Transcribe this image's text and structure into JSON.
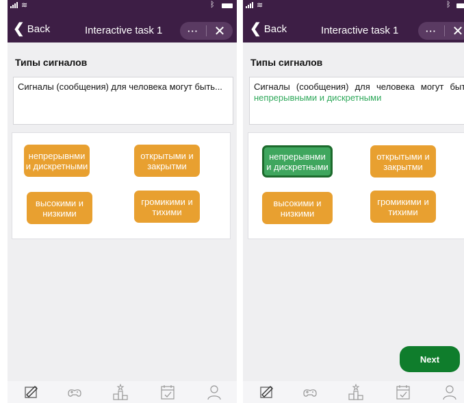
{
  "screens": [
    {
      "header": {
        "back_label": "Back",
        "title": "Interactive task 1",
        "more_glyph": "···",
        "close_glyph": "✕"
      },
      "section_title": "Типы сигналов",
      "question": {
        "text": "Сигналы (сообщения) для человека могут быть...",
        "answer": ""
      },
      "options": [
        {
          "label": "непрерывнми и дискретными",
          "selected": false
        },
        {
          "label": "открытыми и закрытми",
          "selected": false
        },
        {
          "label": "высокими и низкими",
          "selected": false
        },
        {
          "label": "громикими и тихими",
          "selected": false
        }
      ],
      "nav_icons": [
        "tasks-icon",
        "games-icon",
        "leaderboard-icon",
        "calendar-icon",
        "profile-icon"
      ]
    },
    {
      "header": {
        "back_label": "Back",
        "title": "Interactive task 1",
        "more_glyph": "···",
        "close_glyph": "✕"
      },
      "section_title": "Типы сигналов",
      "question": {
        "text": "Сигналы (сообщения) для человека могут быть ",
        "answer": "непрерывными и дискретными"
      },
      "options": [
        {
          "label": "непрерывнми и дискретными",
          "selected": true
        },
        {
          "label": "открытыми и закрытми",
          "selected": false
        },
        {
          "label": "высокими и низкими",
          "selected": false
        },
        {
          "label": "громикими и тихими",
          "selected": false
        }
      ],
      "next_label": "Next",
      "nav_icons": [
        "tasks-icon",
        "games-icon",
        "leaderboard-icon",
        "calendar-icon",
        "profile-icon"
      ]
    }
  ],
  "colors": {
    "header": "#3d1e45",
    "option": "#e8a030",
    "option_selected": "#3fa65e",
    "answer_text": "#2ea85a",
    "next_button": "#0f7d2c"
  }
}
